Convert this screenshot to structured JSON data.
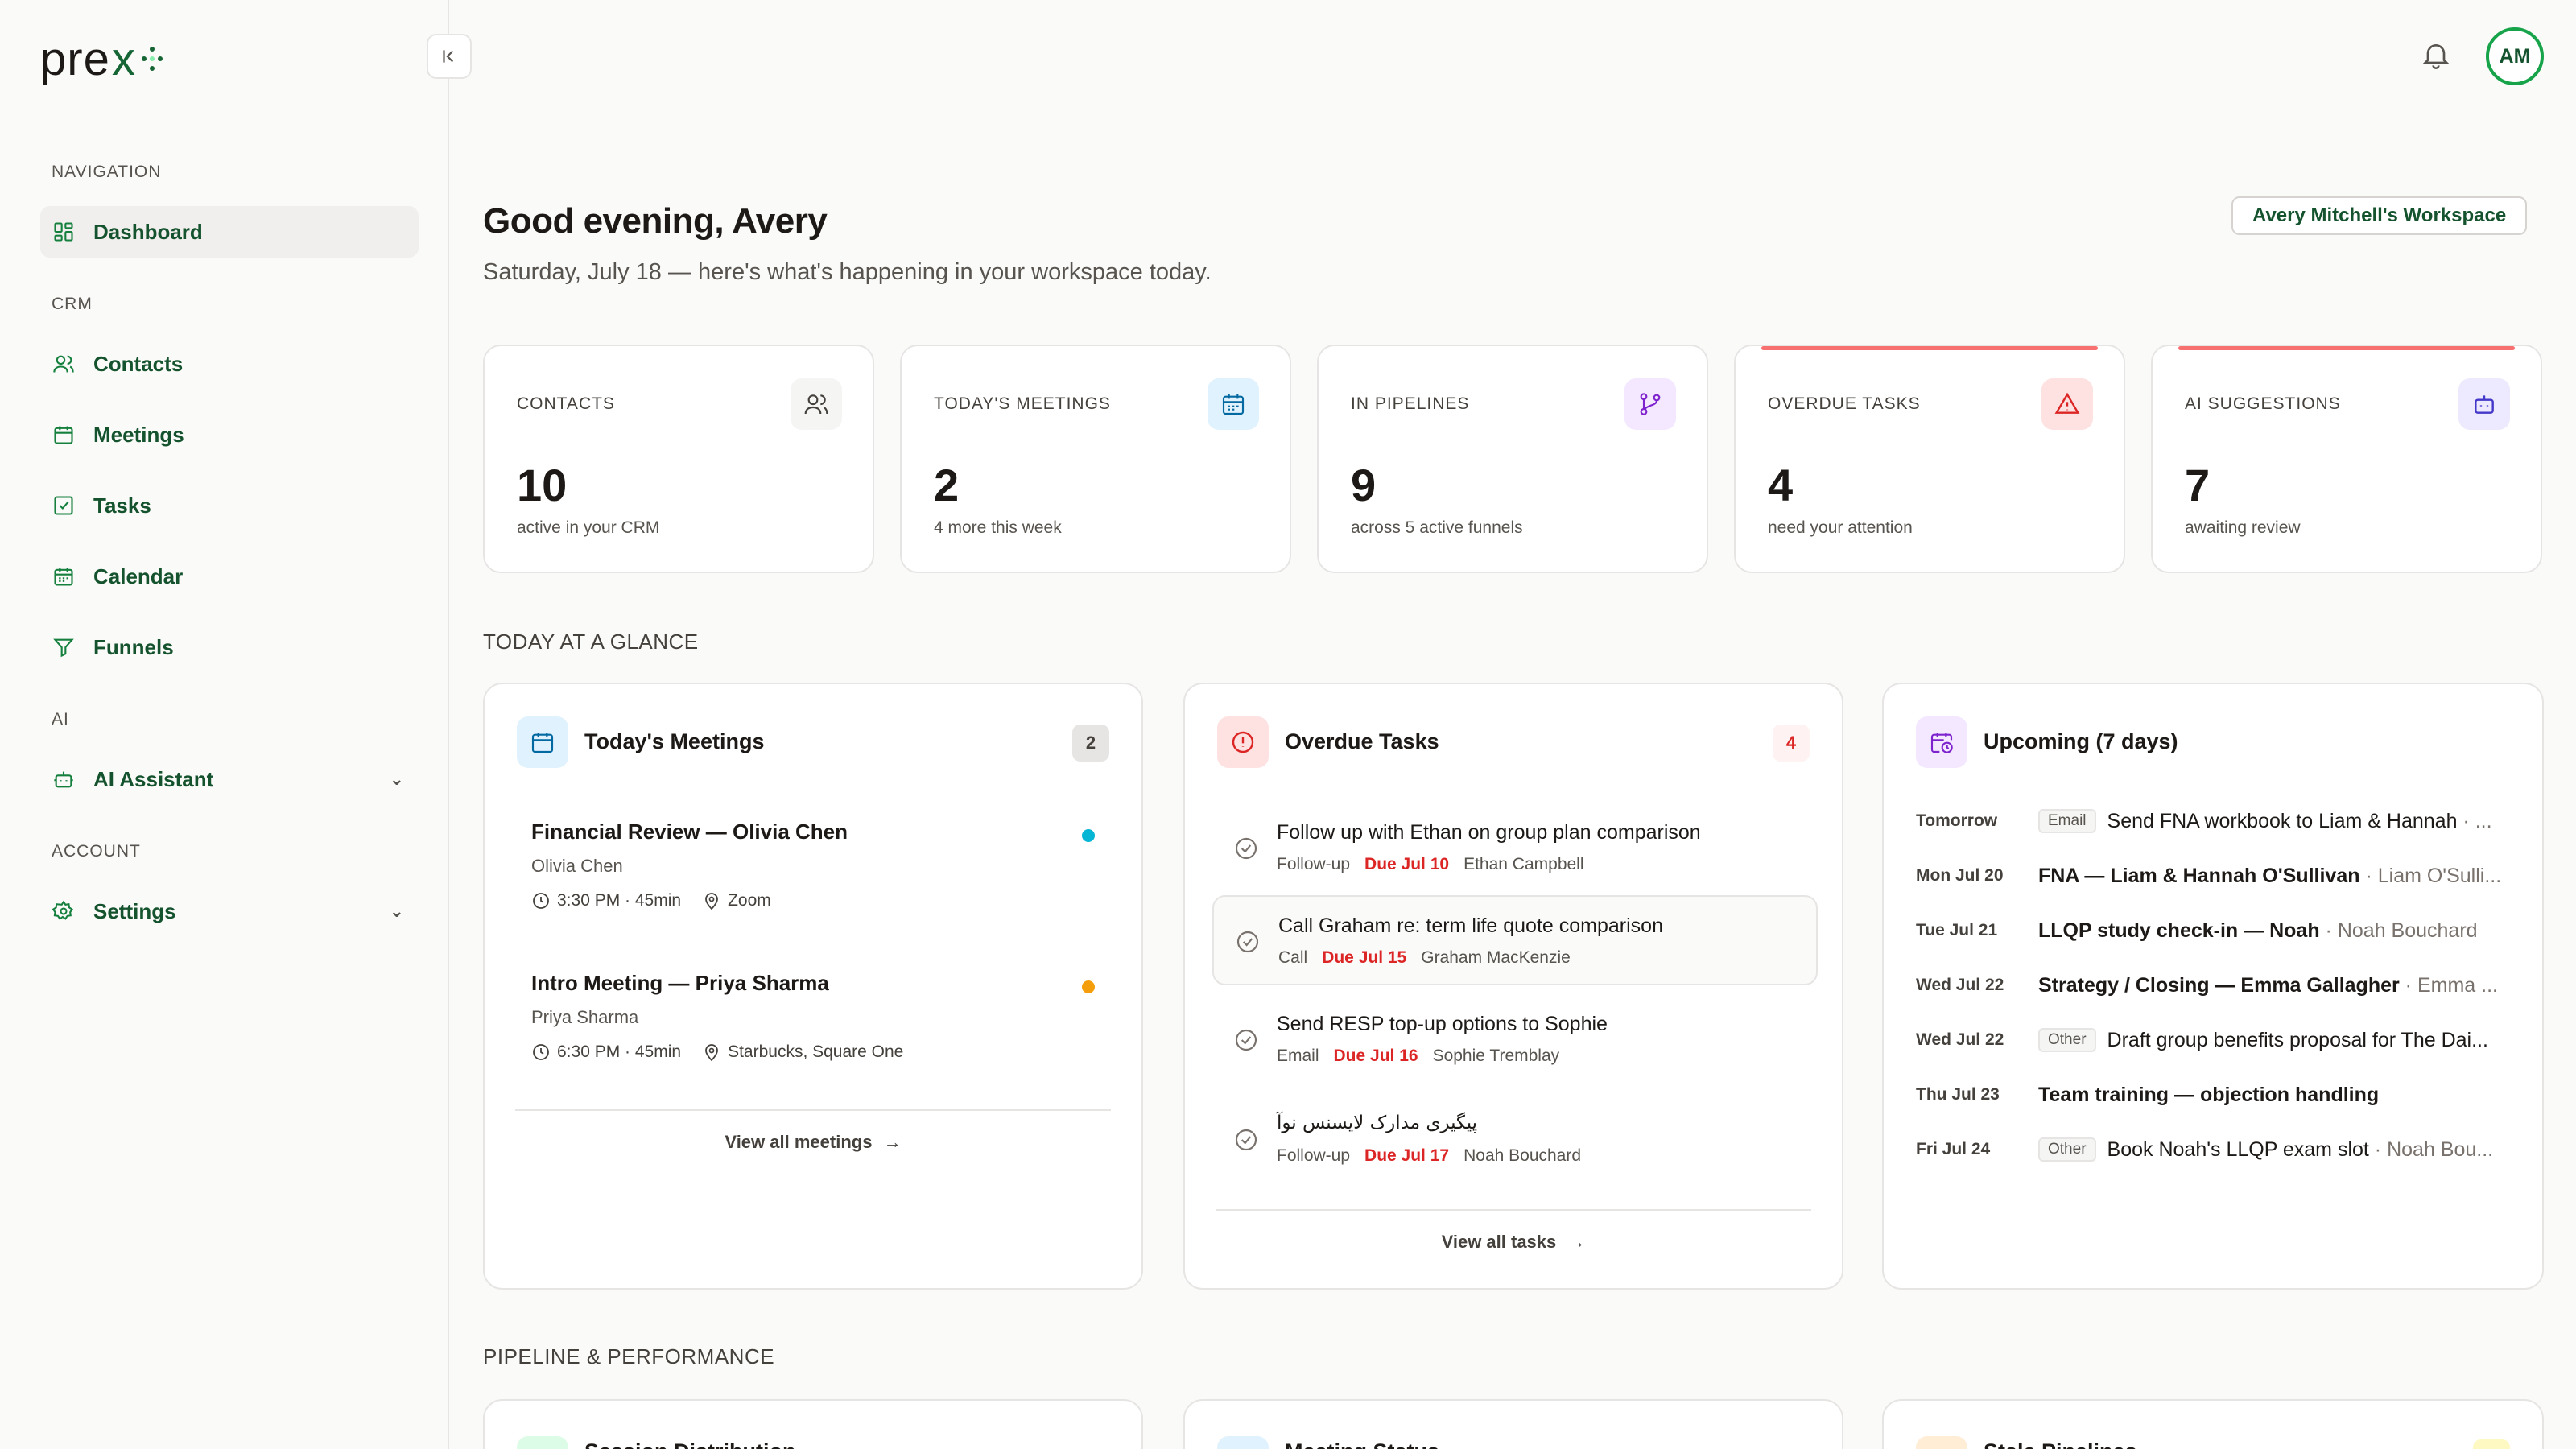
{
  "brand": {
    "name": "pre",
    "mark": "x"
  },
  "nav": {
    "sections": [
      "NAVIGATION",
      "CRM",
      "AI",
      "ACCOUNT"
    ],
    "items": [
      {
        "label": "Dashboard"
      },
      {
        "label": "Contacts"
      },
      {
        "label": "Meetings"
      },
      {
        "label": "Tasks"
      },
      {
        "label": "Calendar"
      },
      {
        "label": "Funnels"
      },
      {
        "label": "AI Assistant"
      },
      {
        "label": "Settings"
      }
    ]
  },
  "user": {
    "initials": "AM"
  },
  "header": {
    "greeting": "Good evening, Avery",
    "subtitle": "Saturday, July 18 — here's what's happening in your workspace today.",
    "workspace": "Avery Mitchell's Workspace"
  },
  "stats": [
    {
      "label": "CONTACTS",
      "value": "10",
      "desc": "active in your CRM"
    },
    {
      "label": "TODAY'S MEETINGS",
      "value": "2",
      "desc": "4 more this week"
    },
    {
      "label": "IN PIPELINES",
      "value": "9",
      "desc": "across 5 active funnels"
    },
    {
      "label": "OVERDUE TASKS",
      "value": "4",
      "desc": "need your attention"
    },
    {
      "label": "AI SUGGESTIONS",
      "value": "7",
      "desc": "awaiting review"
    }
  ],
  "sections": {
    "glance": "TODAY AT A GLANCE",
    "pipeline": "PIPELINE & PERFORMANCE"
  },
  "meetings_panel": {
    "title": "Today's Meetings",
    "count": "2",
    "items": [
      {
        "title": "Financial Review — Olivia Chen",
        "person": "Olivia Chen",
        "time": "3:30 PM · 45min",
        "location": "Zoom",
        "dot": "#06b6d4"
      },
      {
        "title": "Intro Meeting — Priya Sharma",
        "person": "Priya Sharma",
        "time": "6:30 PM · 45min",
        "location": "Starbucks, Square One",
        "dot": "#f59e0b"
      }
    ],
    "link": "View all meetings"
  },
  "tasks_panel": {
    "title": "Overdue Tasks",
    "count": "4",
    "items": [
      {
        "title": "Follow up with Ethan on group plan comparison",
        "type": "Follow-up",
        "due": "Due Jul 10",
        "person": "Ethan Campbell"
      },
      {
        "title": "Call Graham re: term life quote comparison",
        "type": "Call",
        "due": "Due Jul 15",
        "person": "Graham MacKenzie"
      },
      {
        "title": "Send RESP top-up options to Sophie",
        "type": "Email",
        "due": "Due Jul 16",
        "person": "Sophie Tremblay"
      },
      {
        "title": "پیگیری مدارک لایسنس نوآ",
        "type": "Follow-up",
        "due": "Due Jul 17",
        "person": "Noah Bouchard"
      }
    ],
    "link": "View all tasks"
  },
  "upcoming_panel": {
    "title": "Upcoming (7 days)",
    "items": [
      {
        "date": "Tomorrow",
        "badge": "Email",
        "title": "Send FNA workbook to Liam & Hannah",
        "who": " · ...",
        "bold": false
      },
      {
        "date": "Mon Jul 20",
        "badge": "",
        "title": "FNA — Liam & Hannah O'Sullivan",
        "who": " · Liam O'Sulli...",
        "bold": true
      },
      {
        "date": "Tue Jul 21",
        "badge": "",
        "title": "LLQP study check-in — Noah",
        "who": " · Noah Bouchard",
        "bold": true
      },
      {
        "date": "Wed Jul 22",
        "badge": "",
        "title": "Strategy / Closing — Emma Gallagher",
        "who": " · Emma ...",
        "bold": true
      },
      {
        "date": "Wed Jul 22",
        "badge": "Other",
        "title": "Draft group benefits proposal for The Dai...",
        "who": "",
        "bold": false
      },
      {
        "date": "Thu Jul 23",
        "badge": "",
        "title": "Team training — objection handling",
        "who": "",
        "bold": true
      },
      {
        "date": "Fri Jul 24",
        "badge": "Other",
        "title": "Book Noah's LLQP exam slot",
        "who": " · Noah Bou...",
        "bold": false
      }
    ]
  },
  "bottom_cards": [
    {
      "title": "Session Distribution"
    },
    {
      "title": "Meeting Status"
    },
    {
      "title": "Stale Pipelines"
    }
  ]
}
